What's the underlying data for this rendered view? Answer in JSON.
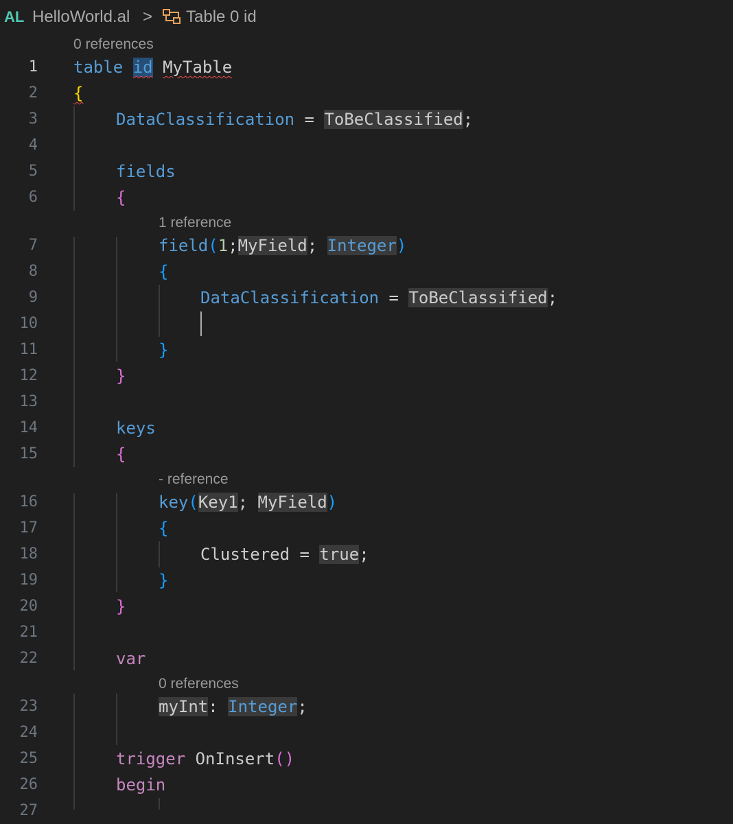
{
  "breadcrumb": {
    "lang_badge": "AL",
    "file": "HelloWorld.al",
    "separator": ">",
    "symbol": "Table 0 id",
    "symbol_icon": "symbol-structure-icon"
  },
  "codelens": {
    "l1": "0 references",
    "l7": "1 reference",
    "l16": "- reference",
    "l23": "0 references"
  },
  "line_numbers": [
    "1",
    "2",
    "3",
    "4",
    "5",
    "6",
    "7",
    "8",
    "9",
    "10",
    "11",
    "12",
    "13",
    "14",
    "15",
    "16",
    "17",
    "18",
    "19",
    "20",
    "21",
    "22",
    "23",
    "24",
    "25",
    "26",
    "27"
  ],
  "tokens": {
    "table": "table",
    "id": "id",
    "mytable": "MyTable",
    "lbrace": "{",
    "rbrace": "}",
    "dataclassification": "DataClassification",
    "eq": " = ",
    "tobeclassified": "ToBeClassified",
    "semi": ";",
    "fields": "fields",
    "field": "field",
    "lparen": "(",
    "rparen": ")",
    "one": "1",
    "myfield": "MyField",
    "semi_space": "; ",
    "integer": "Integer",
    "keys": "keys",
    "key": "key",
    "key1": "Key1",
    "clustered": "Clustered",
    "true": "true",
    "var": "var",
    "myint": "myInt",
    "colon": ": ",
    "trigger": "trigger",
    "oninsert": "OnInsert",
    "parens": "()",
    "begin": "begin"
  },
  "colors": {
    "background": "#1f1f1f",
    "keyword": "#569cd6",
    "control": "#c586c0",
    "number": "#b5cea8",
    "bracket_gold": "#ffd700",
    "bracket_orchid": "#da70d6",
    "bracket_blue": "#179fff",
    "error_squiggle": "#f14c4c",
    "al_badge": "#4ec9b0"
  }
}
